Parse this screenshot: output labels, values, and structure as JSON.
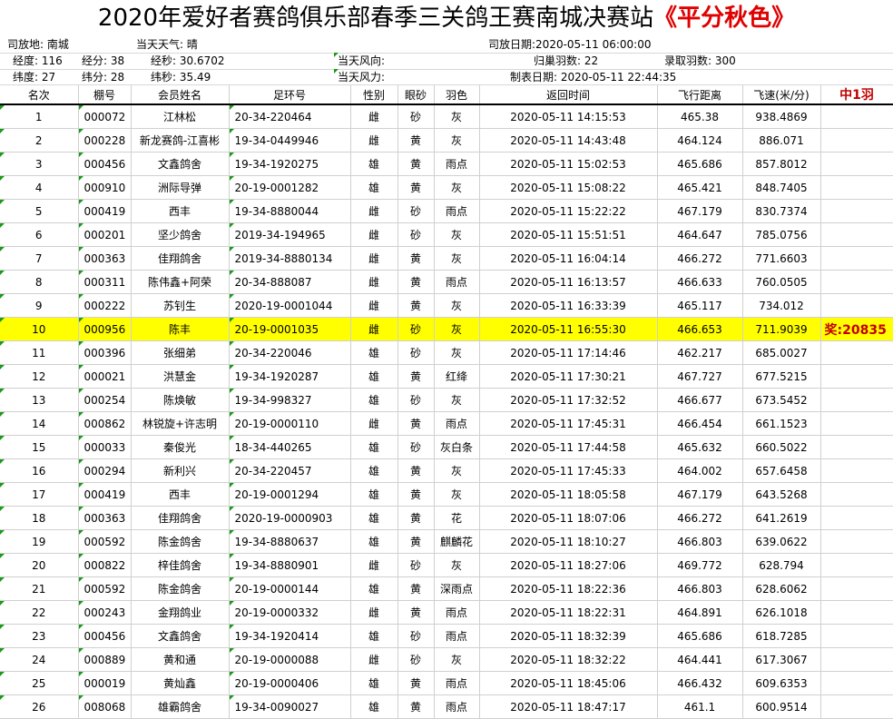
{
  "title": {
    "main": "2020年爱好者赛鸽俱乐部春季三关鸽王赛南城决赛站",
    "accent": "《平分秋色》"
  },
  "info": {
    "release_place": "司放地: 南城",
    "weather": "当天天气: 晴",
    "release_date": "司放日期:2020-05-11 06:00:00",
    "lon_deg": "经度: 116",
    "lon_min": "经分: 38",
    "lon_sec": "经秒: 30.6702",
    "wind_dir": "当天风向:",
    "return_count": "归巢羽数: 22",
    "accepted": "录取羽数: 300",
    "lat_deg": "纬度: 27",
    "lat_min": "纬分: 28",
    "lat_sec": "纬秒: 35.49",
    "wind_force": "当天风力:",
    "made_date": "制表日期: 2020-05-11 22:44:35"
  },
  "headers": [
    "名次",
    "棚号",
    "会员姓名",
    "足环号",
    "性别",
    "眼砂",
    "羽色",
    "返回时间",
    "飞行距离",
    "飞速(米/分)",
    "中1羽"
  ],
  "rows": [
    [
      "1",
      "000072",
      "江林松",
      "20-34-220464",
      "雌",
      "砂",
      "灰",
      "2020-05-11 14:15:53",
      "465.38",
      "938.4869",
      ""
    ],
    [
      "2",
      "000228",
      "新龙赛鸽-江喜彬",
      "19-34-0449946",
      "雌",
      "黄",
      "灰",
      "2020-05-11 14:43:48",
      "464.124",
      "886.071",
      ""
    ],
    [
      "3",
      "000456",
      "文鑫鸽舍",
      "19-34-1920275",
      "雄",
      "黄",
      "雨点",
      "2020-05-11 15:02:53",
      "465.686",
      "857.8012",
      ""
    ],
    [
      "4",
      "000910",
      "洲际导弹",
      "20-19-0001282",
      "雄",
      "黄",
      "灰",
      "2020-05-11 15:08:22",
      "465.421",
      "848.7405",
      ""
    ],
    [
      "5",
      "000419",
      "西丰",
      "19-34-8880044",
      "雌",
      "砂",
      "雨点",
      "2020-05-11 15:22:22",
      "467.179",
      "830.7374",
      ""
    ],
    [
      "6",
      "000201",
      "坚少鸽舍",
      "2019-34-194965",
      "雌",
      "砂",
      "灰",
      "2020-05-11 15:51:51",
      "464.647",
      "785.0756",
      ""
    ],
    [
      "7",
      "000363",
      "佳翔鸽舍",
      "2019-34-8880134",
      "雌",
      "黄",
      "灰",
      "2020-05-11 16:04:14",
      "466.272",
      "771.6603",
      ""
    ],
    [
      "8",
      "000311",
      "陈伟鑫+阿荣",
      "20-34-888087",
      "雌",
      "黄",
      "雨点",
      "2020-05-11 16:13:57",
      "466.633",
      "760.0505",
      ""
    ],
    [
      "9",
      "000222",
      "苏钊生",
      "2020-19-0001044",
      "雌",
      "黄",
      "灰",
      "2020-05-11 16:33:39",
      "465.117",
      "734.012",
      ""
    ],
    [
      "10",
      "000956",
      "陈丰",
      "20-19-0001035",
      "雌",
      "砂",
      "灰",
      "2020-05-11 16:55:30",
      "466.653",
      "711.9039",
      "奖:20835"
    ],
    [
      "11",
      "000396",
      "张细弟",
      "20-34-220046",
      "雄",
      "砂",
      "灰",
      "2020-05-11 17:14:46",
      "462.217",
      "685.0027",
      ""
    ],
    [
      "12",
      "000021",
      "洪慧金",
      "19-34-1920287",
      "雄",
      "黄",
      "红绛",
      "2020-05-11 17:30:21",
      "467.727",
      "677.5215",
      ""
    ],
    [
      "13",
      "000254",
      "陈焕敏",
      "19-34-998327",
      "雄",
      "砂",
      "灰",
      "2020-05-11 17:32:52",
      "466.677",
      "673.5452",
      ""
    ],
    [
      "14",
      "000862",
      "林锐旋+许志明",
      "20-19-0000110",
      "雌",
      "黄",
      "雨点",
      "2020-05-11 17:45:31",
      "466.454",
      "661.1523",
      ""
    ],
    [
      "15",
      "000033",
      "秦俊光",
      "18-34-440265",
      "雄",
      "砂",
      "灰白条",
      "2020-05-11 17:44:58",
      "465.632",
      "660.5022",
      ""
    ],
    [
      "16",
      "000294",
      "新利兴",
      "20-34-220457",
      "雄",
      "黄",
      "灰",
      "2020-05-11 17:45:33",
      "464.002",
      "657.6458",
      ""
    ],
    [
      "17",
      "000419",
      "西丰",
      "20-19-0001294",
      "雄",
      "黄",
      "灰",
      "2020-05-11 18:05:58",
      "467.179",
      "643.5268",
      ""
    ],
    [
      "18",
      "000363",
      "佳翔鸽舍",
      "2020-19-0000903",
      "雄",
      "黄",
      "花",
      "2020-05-11 18:07:06",
      "466.272",
      "641.2619",
      ""
    ],
    [
      "19",
      "000592",
      "陈金鸽舍",
      "19-34-8880637",
      "雄",
      "黄",
      "麒麟花",
      "2020-05-11 18:10:27",
      "466.803",
      "639.0622",
      ""
    ],
    [
      "20",
      "000822",
      "梓佳鸽舍",
      "19-34-8880901",
      "雌",
      "砂",
      "灰",
      "2020-05-11 18:27:06",
      "469.772",
      "628.794",
      ""
    ],
    [
      "21",
      "000592",
      "陈金鸽舍",
      "20-19-0000144",
      "雄",
      "黄",
      "深雨点",
      "2020-05-11 18:22:36",
      "466.803",
      "628.6062",
      ""
    ],
    [
      "22",
      "000243",
      "金翔鸽业",
      "20-19-0000332",
      "雌",
      "黄",
      "雨点",
      "2020-05-11 18:22:31",
      "464.891",
      "626.1018",
      ""
    ],
    [
      "23",
      "000456",
      "文鑫鸽舍",
      "19-34-1920414",
      "雄",
      "砂",
      "雨点",
      "2020-05-11 18:32:39",
      "465.686",
      "618.7285",
      ""
    ],
    [
      "24",
      "000889",
      "黄和通",
      "20-19-0000088",
      "雌",
      "砂",
      "灰",
      "2020-05-11 18:32:22",
      "464.441",
      "617.3067",
      ""
    ],
    [
      "25",
      "000019",
      "黄灿鑫",
      "20-19-0000406",
      "雄",
      "黄",
      "雨点",
      "2020-05-11 18:45:06",
      "466.432",
      "609.6353",
      ""
    ],
    [
      "26",
      "008068",
      "雄霸鸽舍",
      "19-34-0090027",
      "雄",
      "黄",
      "雨点",
      "2020-05-11 18:47:17",
      "461.1",
      "600.9514",
      ""
    ]
  ],
  "highlight_row": "10",
  "colors": {
    "highlight": "#ffff00",
    "accent_red": "#c00000",
    "cell_mark": "#1a9a1a"
  }
}
